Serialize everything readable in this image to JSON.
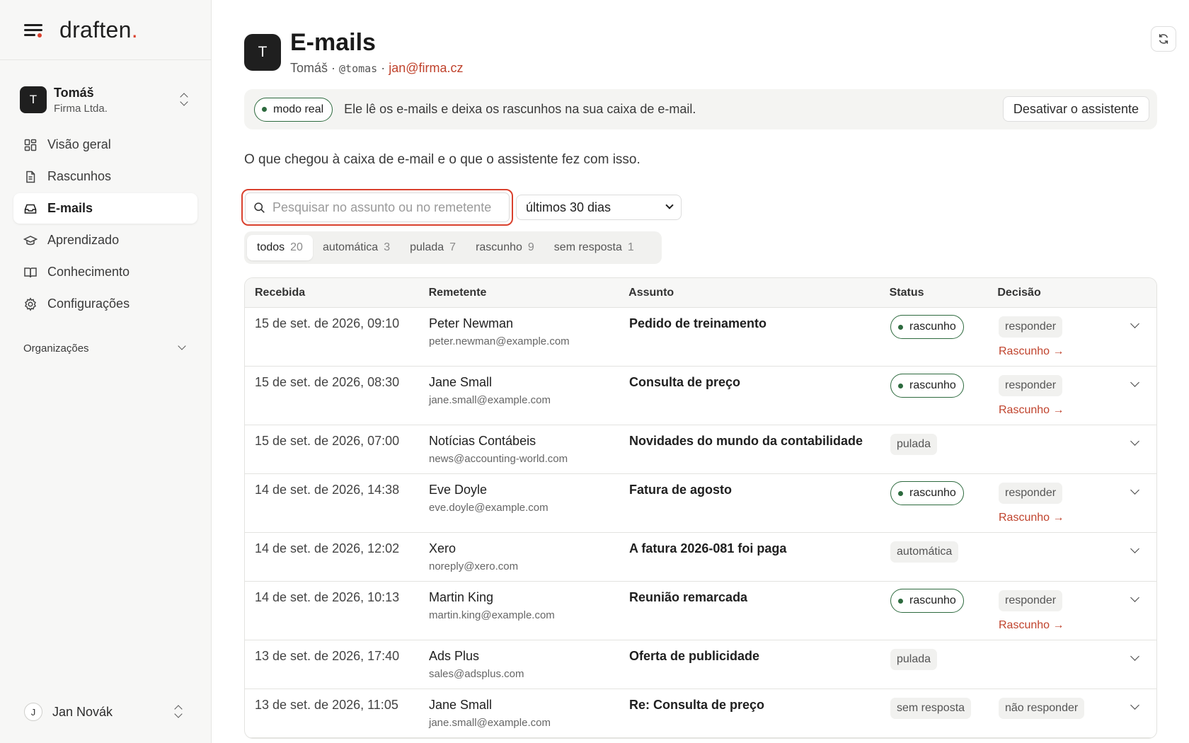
{
  "sidebar": {
    "logo": "draften",
    "account": {
      "initial": "T",
      "name": "Tomáš",
      "org": "Firma Ltda."
    },
    "nav": [
      {
        "label": "Visão geral",
        "icon": "dashboard-icon"
      },
      {
        "label": "Rascunhos",
        "icon": "document-icon"
      },
      {
        "label": "E-mails",
        "icon": "inbox-icon",
        "active": true
      },
      {
        "label": "Aprendizado",
        "icon": "graduation-cap-icon"
      },
      {
        "label": "Conhecimento",
        "icon": "book-icon"
      },
      {
        "label": "Configurações",
        "icon": "gear-icon"
      }
    ],
    "orgs_label": "Organizações",
    "user": {
      "initial": "J",
      "name": "Jan Novák"
    }
  },
  "header": {
    "initial": "T",
    "title": "E-mails",
    "name": "Tomáš",
    "handle": "@tomas",
    "email": "jan@firma.cz"
  },
  "banner": {
    "badge": "modo real",
    "text": "Ele lê os e-mails e deixa os rascunhos na sua caixa de e-mail.",
    "button": "Desativar o assistente"
  },
  "description": "O que chegou à caixa de e-mail e o que o assistente fez com isso.",
  "search": {
    "placeholder": "Pesquisar no assunto ou no remetente",
    "value": ""
  },
  "period": "últimos 30 dias",
  "tabs": [
    {
      "label": "todos",
      "count": "20"
    },
    {
      "label": "automática",
      "count": "3"
    },
    {
      "label": "pulada",
      "count": "7"
    },
    {
      "label": "rascunho",
      "count": "9"
    },
    {
      "label": "sem resposta",
      "count": "1"
    }
  ],
  "table": {
    "headers": [
      "Recebida",
      "Remetente",
      "Assunto",
      "Status",
      "Decisão"
    ],
    "draft_link": "Rascunho →",
    "rows": [
      {
        "date": "15 de set. de 2026, 09:10",
        "name": "Peter Newman",
        "email": "peter.newman@example.com",
        "subject": "Pedido de treinamento",
        "status": "rascunho",
        "decision": "responder"
      },
      {
        "date": "15 de set. de 2026, 08:30",
        "name": "Jane Small",
        "email": "jane.small@example.com",
        "subject": "Consulta de preço",
        "status": "rascunho",
        "decision": "responder"
      },
      {
        "date": "15 de set. de 2026, 07:00",
        "name": "Notícias Contábeis",
        "email": "news@accounting-world.com",
        "subject": "Novidades do mundo da contabilidade",
        "status": "pulada",
        "decision": ""
      },
      {
        "date": "14 de set. de 2026, 14:38",
        "name": "Eve Doyle",
        "email": "eve.doyle@example.com",
        "subject": "Fatura de agosto",
        "status": "rascunho",
        "decision": "responder"
      },
      {
        "date": "14 de set. de 2026, 12:02",
        "name": "Xero",
        "email": "noreply@xero.com",
        "subject": "A fatura 2026-081 foi paga",
        "status": "automática",
        "decision": ""
      },
      {
        "date": "14 de set. de 2026, 10:13",
        "name": "Martin King",
        "email": "martin.king@example.com",
        "subject": "Reunião remarcada",
        "status": "rascunho",
        "decision": "responder"
      },
      {
        "date": "13 de set. de 2026, 17:40",
        "name": "Ads Plus",
        "email": "sales@adsplus.com",
        "subject": "Oferta de publicidade",
        "status": "pulada",
        "decision": ""
      },
      {
        "date": "13 de set. de 2026, 11:05",
        "name": "Jane Small",
        "email": "jane.small@example.com",
        "subject": "Re: Consulta de preço",
        "status": "sem resposta",
        "decision": "não responder"
      }
    ]
  }
}
